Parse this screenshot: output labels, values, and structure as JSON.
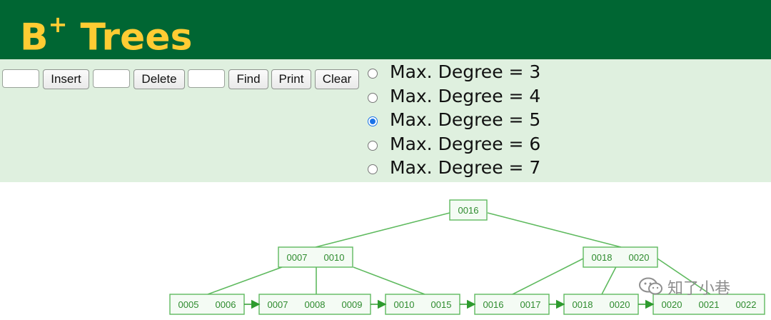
{
  "header": {
    "title_main": "B",
    "title_sup": "+",
    "title_rest": " Trees"
  },
  "controls": {
    "insert_value": "",
    "insert_label": "Insert",
    "delete_value": "",
    "delete_label": "Delete",
    "find_value": "",
    "find_label": "Find",
    "print_label": "Print",
    "clear_label": "Clear",
    "degree_options": [
      {
        "label": "Max. Degree = 3",
        "checked": false
      },
      {
        "label": "Max. Degree = 4",
        "checked": false
      },
      {
        "label": "Max. Degree = 5",
        "checked": true
      },
      {
        "label": "Max. Degree = 6",
        "checked": false
      },
      {
        "label": "Max. Degree = 7",
        "checked": false
      }
    ]
  },
  "tree": {
    "root": [
      "0016"
    ],
    "internal": [
      [
        "0007",
        "0010"
      ],
      [
        "0018",
        "0020"
      ]
    ],
    "leaves": [
      [
        "0005",
        "0006"
      ],
      [
        "0007",
        "0008",
        "0009"
      ],
      [
        "0010",
        "0015"
      ],
      [
        "0016",
        "0017"
      ],
      [
        "0018",
        "0020"
      ],
      [
        "0020",
        "0021",
        "0022"
      ]
    ]
  },
  "colors": {
    "header_bg": "#006633",
    "title": "#ffcc33",
    "controls_bg": "#dff0df",
    "tree_stroke": "#5fba5f",
    "tree_text": "#2e8b2e"
  },
  "watermark": {
    "text": "知了小巷"
  }
}
